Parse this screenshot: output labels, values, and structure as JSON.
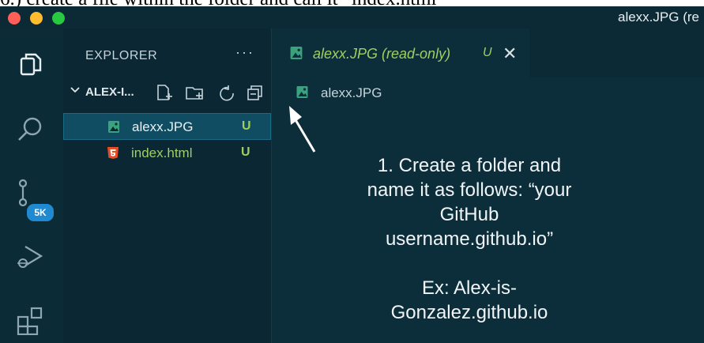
{
  "caption": {
    "text": "6.) create a file within the folder and call it “index.html”"
  },
  "window": {
    "title": "alexx.JPG (re"
  },
  "activity_bar": {
    "badge": "5K"
  },
  "sidebar": {
    "title": "EXPLORER",
    "more": "···",
    "folder": {
      "label": "ALEX-I..."
    },
    "files": [
      {
        "name": "alexx.JPG",
        "status": "U",
        "color": "#e8f0f3",
        "icon": "image-file-icon"
      },
      {
        "name": "index.html",
        "status": "U",
        "color": "#9fcf63",
        "icon": "html5-file-icon"
      }
    ]
  },
  "editor": {
    "tab": {
      "label": "alexx.JPG (read-only)",
      "status": "U",
      "close": "✕"
    },
    "breadcrumb": "alexx.JPG"
  },
  "annotation": {
    "text": "1. Create a folder and\nname it as follows: “your\nGitHub\nusername.github.io”\n\nEx: Alex-is-\nGonzalez.github.io"
  },
  "colors": {
    "accent_green": "#9fcf63",
    "badge_blue": "#1f8ad2",
    "html_orange": "#e44d26"
  }
}
